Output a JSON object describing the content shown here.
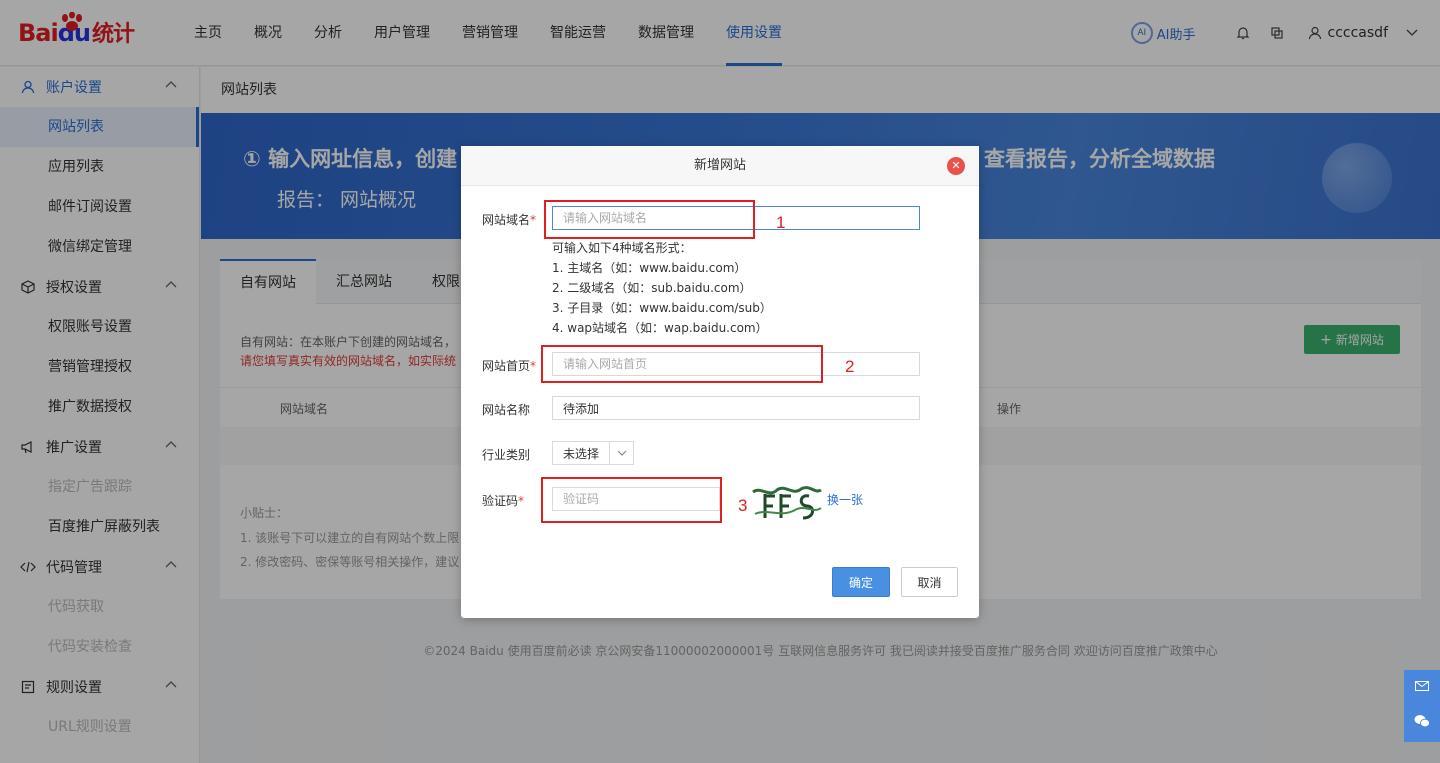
{
  "header": {
    "logo_bai": "Bai",
    "logo_du": "du",
    "logo_tongji": "统计",
    "nav": [
      {
        "label": "主页"
      },
      {
        "label": "概况"
      },
      {
        "label": "分析"
      },
      {
        "label": "用户管理"
      },
      {
        "label": "营销管理"
      },
      {
        "label": "智能运营"
      },
      {
        "label": "数据管理"
      },
      {
        "label": "使用设置",
        "active": true
      }
    ],
    "ai_label": "AI助手",
    "username": "ccccasdf"
  },
  "sidebar": {
    "groups": [
      {
        "label": "账户设置",
        "icon": "user-icon",
        "items": [
          {
            "label": "网站列表",
            "state": "active"
          },
          {
            "label": "应用列表"
          },
          {
            "label": "邮件订阅设置"
          },
          {
            "label": "微信绑定管理"
          }
        ]
      },
      {
        "label": "授权设置",
        "icon": "cube-icon",
        "items": [
          {
            "label": "权限账号设置"
          },
          {
            "label": "营销管理授权"
          },
          {
            "label": "推广数据授权"
          }
        ]
      },
      {
        "label": "推广设置",
        "icon": "megaphone-icon",
        "items": [
          {
            "label": "指定广告跟踪",
            "state": "disabled"
          },
          {
            "label": "百度推广屏蔽列表"
          }
        ]
      },
      {
        "label": "代码管理",
        "icon": "code-icon",
        "items": [
          {
            "label": "代码获取",
            "state": "disabled"
          },
          {
            "label": "代码安装检查",
            "state": "disabled"
          }
        ]
      },
      {
        "label": "规则设置",
        "icon": "rule-icon",
        "items": [
          {
            "label": "URL规则设置",
            "state": "disabled"
          }
        ]
      }
    ]
  },
  "main": {
    "breadcrumb": "网站列表",
    "banner_line1": "① 输入网址信息，创建",
    "banner_line1_right": "查看报告，分析全域数据",
    "banner_line2": "报告： 网站概况",
    "tabs": [
      "自有网站",
      "汇总网站",
      "权限"
    ],
    "desc": "自有网站：在本账户下创建的网站域名，",
    "warn": "请您填写真实有效的网站域名，如实际统",
    "add_site": "新增网站",
    "col_domain": "网站域名",
    "col_action": "操作",
    "tips_title": "小贴士：",
    "tip1": "1. 该账号下可以建立的自有网站个数上限",
    "tip2": "2. 修改密码、密保等账号相关操作，建议",
    "footer": "©2024 Baidu 使用百度前必读 京公网安备11000002000001号 互联网信息服务许可 我已阅读并接受百度推广服务合同 欢迎访问百度推广政策中心"
  },
  "modal": {
    "title": "新增网站",
    "domain_label": "网站域名",
    "domain_placeholder": "请输入网站域名",
    "hint_title": "可输入如下4种域名形式：",
    "hints": [
      "1. 主域名（如：www.baidu.com）",
      "2. 二级域名（如：sub.baidu.com）",
      "3. 子目录（如：www.baidu.com/sub）",
      "4. wap站域名（如：wap.baidu.com）"
    ],
    "home_label": "网站首页",
    "home_placeholder": "请输入网站首页",
    "name_label": "网站名称",
    "name_value": "待添加",
    "industry_label": "行业类别",
    "industry_value": "未选择",
    "captcha_label": "验证码",
    "captcha_placeholder": "验证码",
    "refresh_label": "换一张",
    "ok_label": "确定",
    "cancel_label": "取消",
    "required_mark": "*"
  },
  "annotations": [
    "1",
    "2",
    "3"
  ],
  "colors": {
    "accent": "#2c6ed5",
    "annotation": "#e02020",
    "add_button": "#3bb16f"
  }
}
